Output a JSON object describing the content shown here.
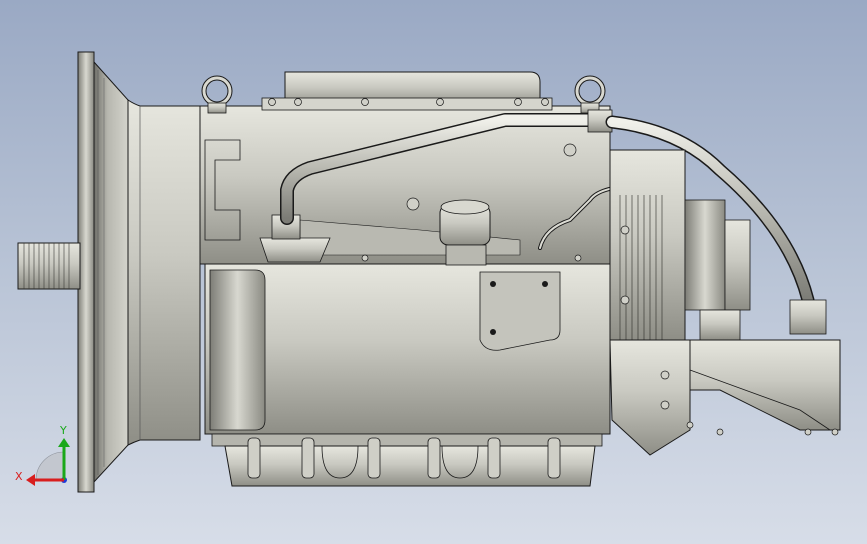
{
  "viewport": {
    "background_top": "#9aa9c4",
    "background_bottom": "#d7dde8",
    "model_fill": "#c8c8c0",
    "model_shadow": "#8e8e86",
    "edge_color": "#1a1a1a"
  },
  "triad": {
    "x_label": "X",
    "y_label": "Y",
    "x_color": "#d81e1e",
    "y_color": "#1aa81a",
    "z_color": "#1e3cd8"
  }
}
